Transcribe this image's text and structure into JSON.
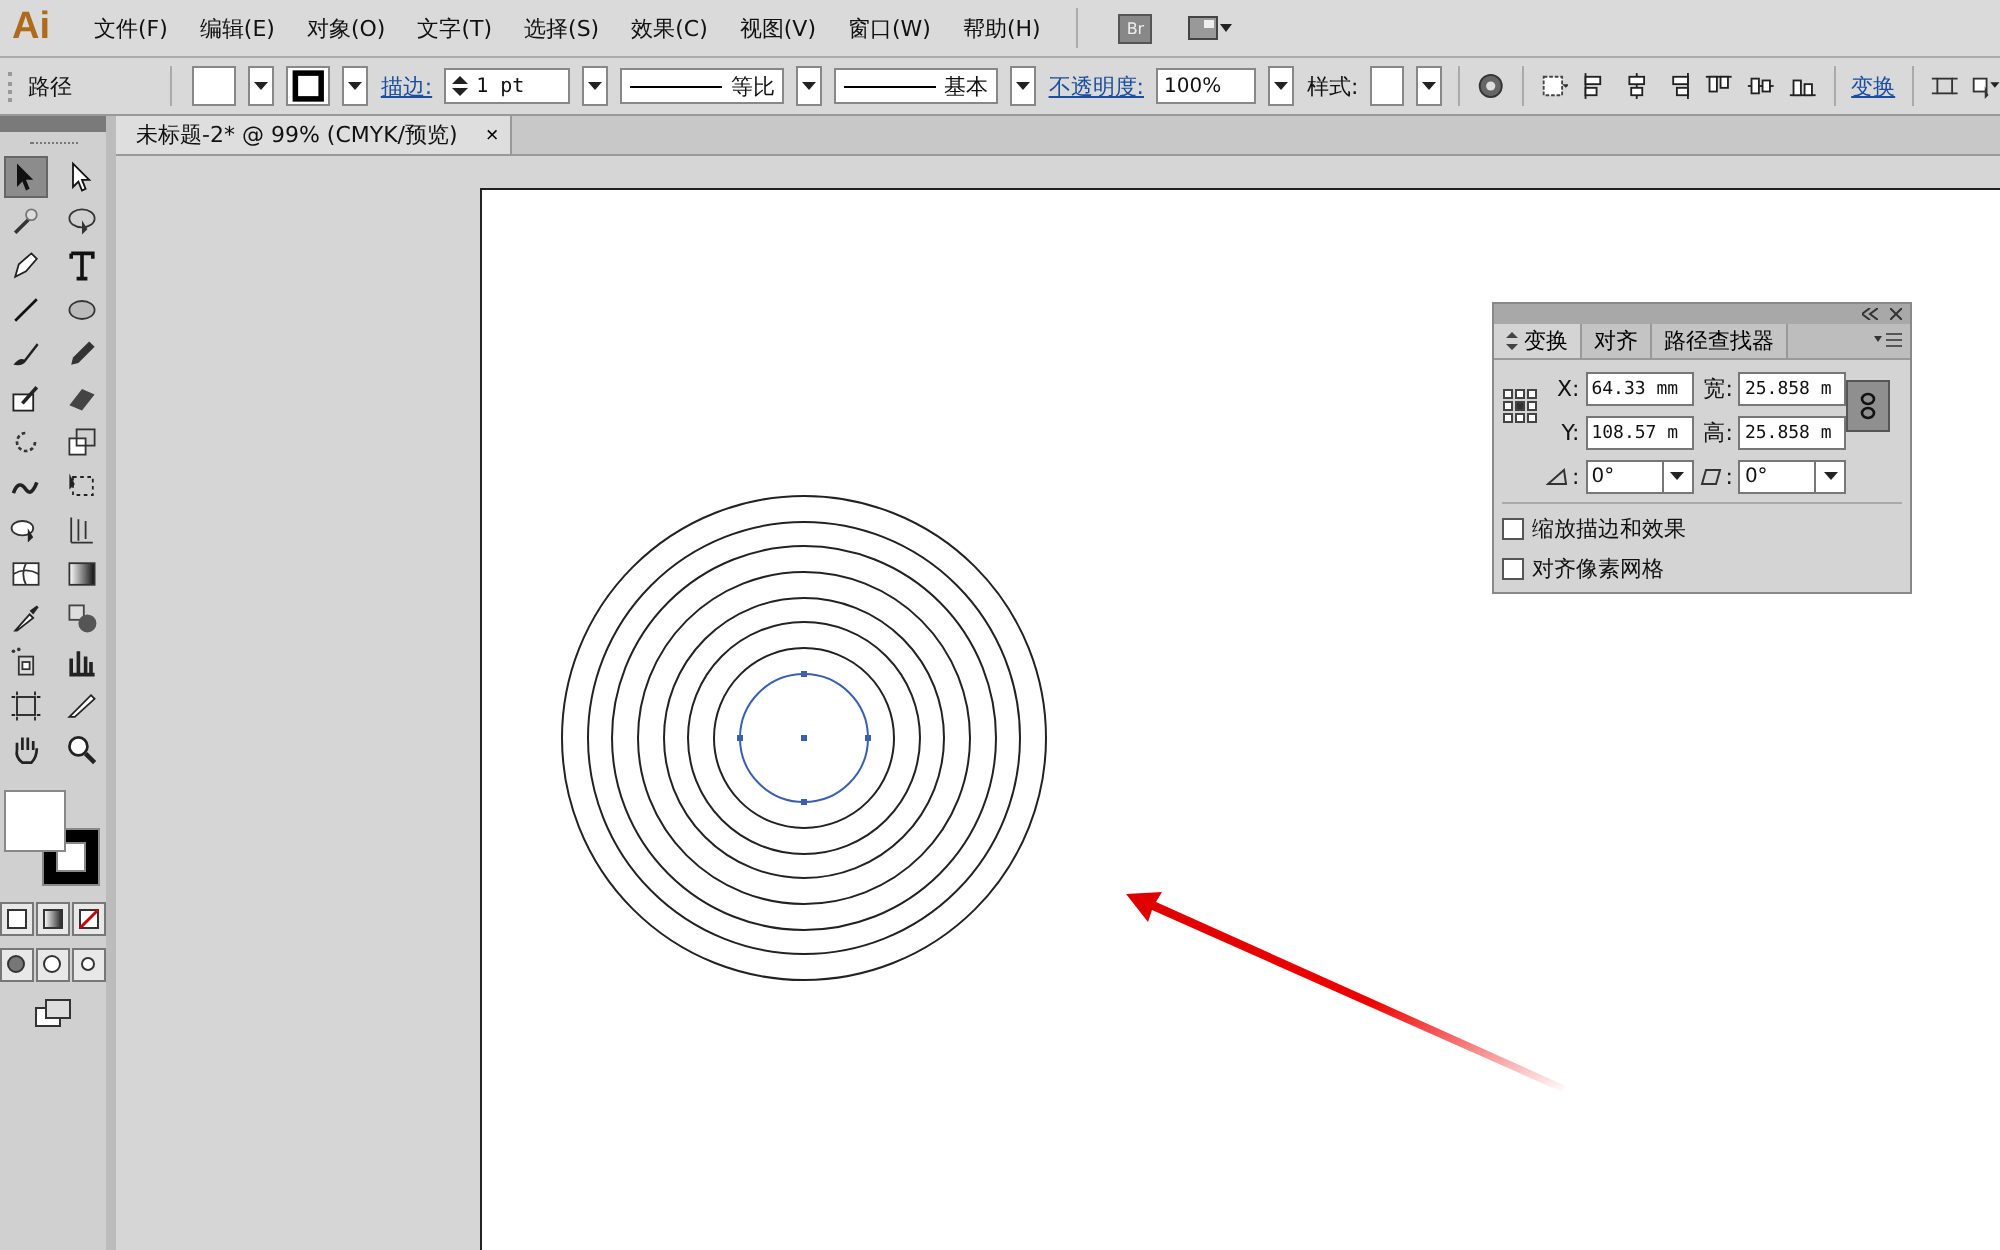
{
  "menu_bar": {
    "logo": "Ai",
    "items": [
      "文件(F)",
      "编辑(E)",
      "对象(O)",
      "文字(T)",
      "选择(S)",
      "效果(C)",
      "视图(V)",
      "窗口(W)",
      "帮助(H)"
    ],
    "bridge": "Br"
  },
  "control_bar": {
    "label": "路径",
    "stroke_link": "描边:",
    "stroke_weight": "1 pt",
    "profile": "等比",
    "brush": "基本",
    "opacity_link": "不透明度:",
    "opacity": "100%",
    "style_label": "样式:",
    "transform_link": "变换"
  },
  "tools": [
    {
      "kind": "selection",
      "selected": true
    },
    {
      "kind": "direct-selection",
      "selected": false
    },
    {
      "kind": "magic-wand",
      "selected": false
    },
    {
      "kind": "lasso",
      "selected": false
    },
    {
      "kind": "pen",
      "selected": false
    },
    {
      "kind": "type",
      "selected": false
    },
    {
      "kind": "line",
      "selected": false
    },
    {
      "kind": "ellipse",
      "selected": false
    },
    {
      "kind": "brush",
      "selected": false
    },
    {
      "kind": "pencil",
      "selected": false
    },
    {
      "kind": "blob-brush",
      "selected": false
    },
    {
      "kind": "eraser",
      "selected": false
    },
    {
      "kind": "rotate",
      "selected": false
    },
    {
      "kind": "scale",
      "selected": false
    },
    {
      "kind": "warp",
      "selected": false
    },
    {
      "kind": "free-transform",
      "selected": false
    },
    {
      "kind": "shape-builder",
      "selected": false
    },
    {
      "kind": "perspective",
      "selected": false
    },
    {
      "kind": "mesh",
      "selected": false
    },
    {
      "kind": "gradient",
      "selected": false
    },
    {
      "kind": "eyedropper",
      "selected": false
    },
    {
      "kind": "blend",
      "selected": false
    },
    {
      "kind": "sprayer",
      "selected": false
    },
    {
      "kind": "graph",
      "selected": false
    },
    {
      "kind": "artboard",
      "selected": false
    },
    {
      "kind": "slice",
      "selected": false
    },
    {
      "kind": "hand",
      "selected": false
    },
    {
      "kind": "zoom",
      "selected": false
    }
  ],
  "document_tab": {
    "title": "未标题-2* @ 99% (CMYK/预览)",
    "close": "×"
  },
  "transform_panel": {
    "tabs": [
      {
        "label": "变换",
        "selected": true
      },
      {
        "label": "对齐",
        "selected": false
      },
      {
        "label": "路径查找器",
        "selected": false
      }
    ],
    "fields": [
      {
        "label": "X:",
        "value": "64.33 mm"
      },
      {
        "label": "宽:",
        "value": "25.858 m"
      },
      {
        "label": "Y:",
        "value": "108.57 m"
      },
      {
        "label": "高:",
        "value": "25.858 m"
      }
    ],
    "angle": {
      "label": ":",
      "value": "0°"
    },
    "shear": {
      "label": ":",
      "value": "0°"
    },
    "checkboxes": [
      {
        "label": "缩放描边和效果",
        "checked": false
      },
      {
        "label": "对齐像素网格",
        "checked": false
      }
    ]
  }
}
